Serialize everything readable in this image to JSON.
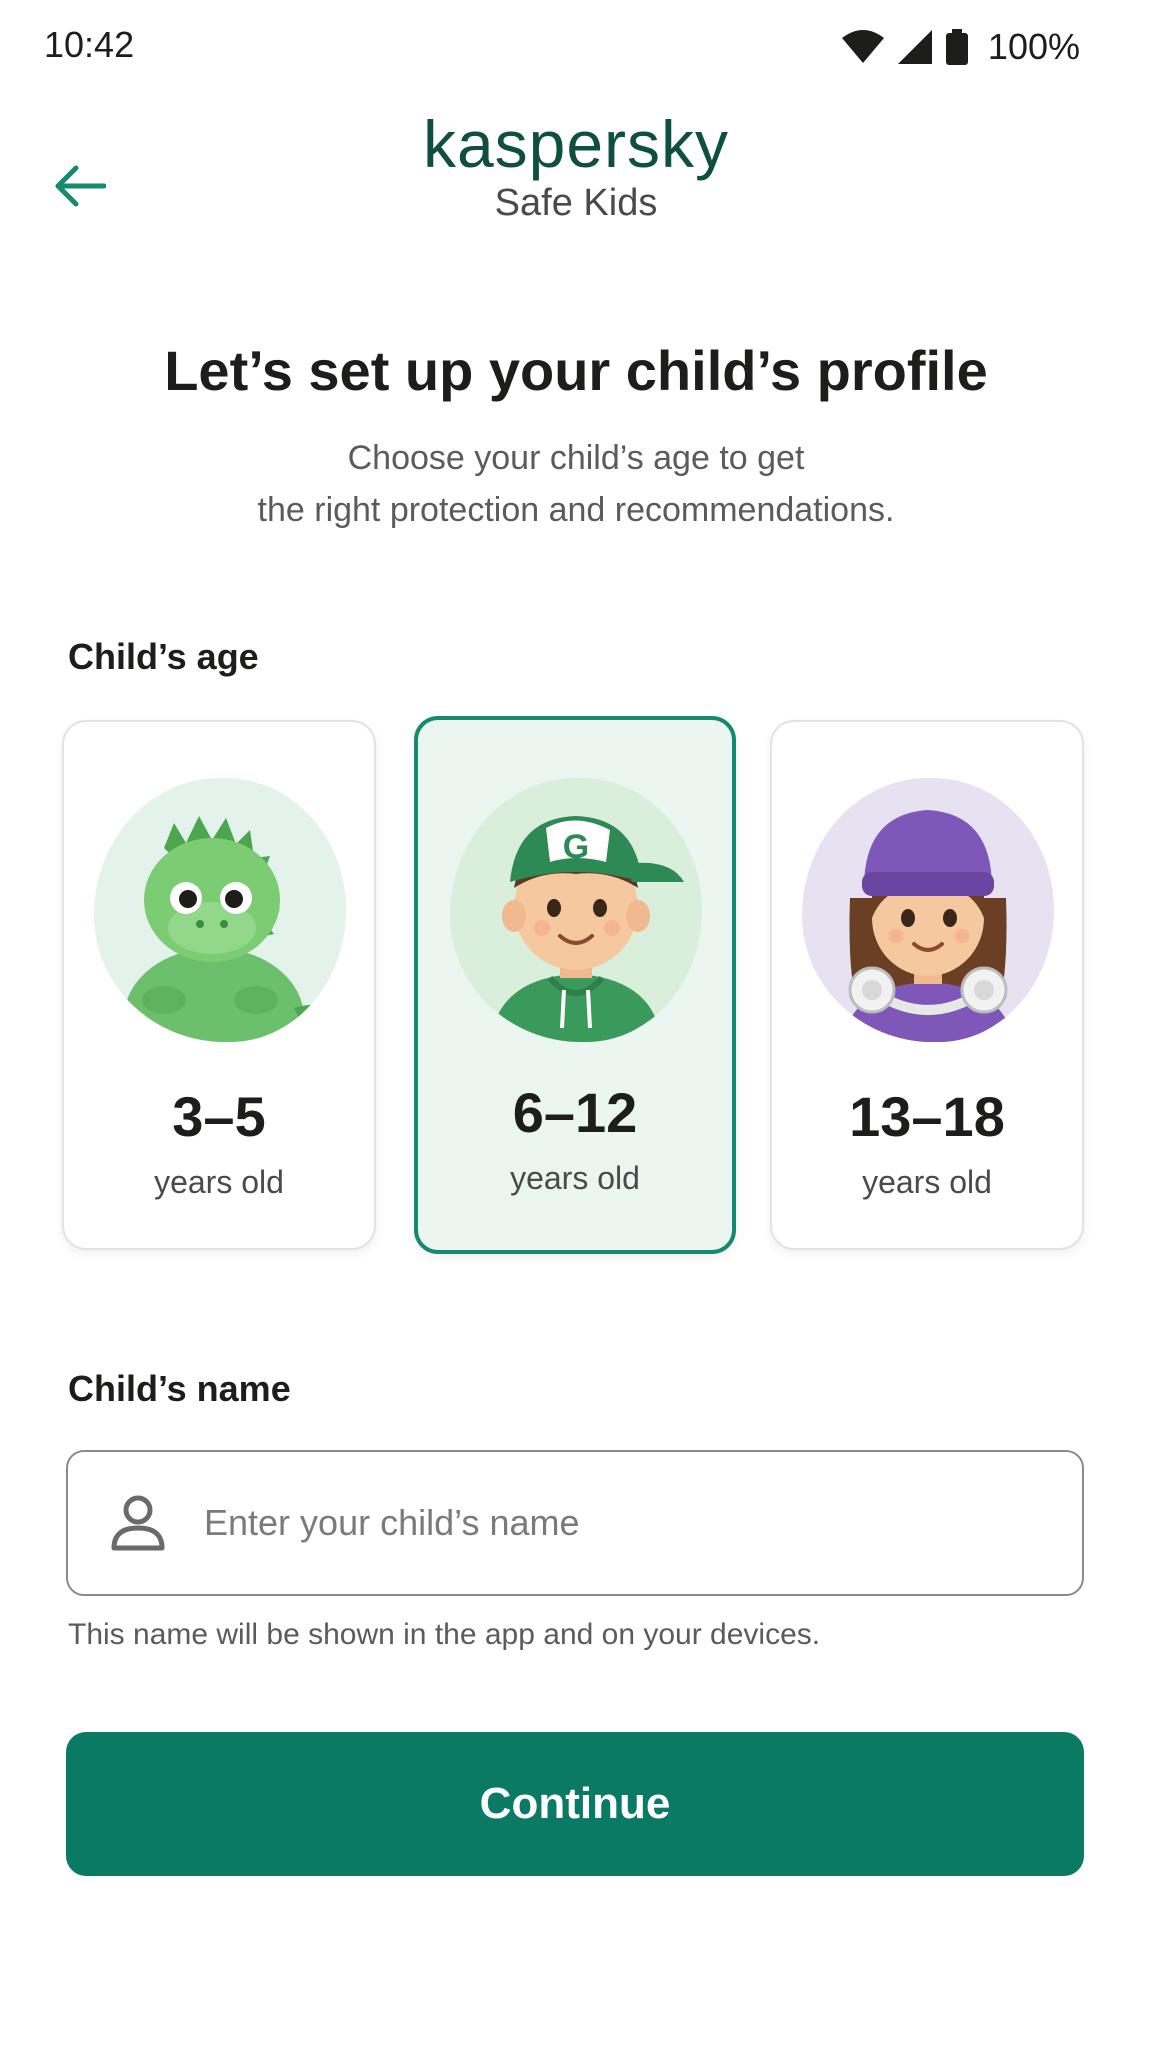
{
  "status_bar": {
    "time": "10:42",
    "battery": "100%",
    "icons": [
      "wifi-icon",
      "signal-icon",
      "battery-icon"
    ]
  },
  "header": {
    "back_icon": "arrow-left-icon",
    "brand_name": "kaspersky",
    "product_name": "Safe Kids"
  },
  "intro": {
    "title": "Let’s set up your child’s profile",
    "subtitle_line1": "Choose your child’s age to get",
    "subtitle_line2": "the right protection and recommendations."
  },
  "age_section": {
    "label": "Child’s age",
    "options": [
      {
        "range": "3–5",
        "unit": "years old",
        "avatar": "dinosaur-avatar",
        "selected": false
      },
      {
        "range": "6–12",
        "unit": "years old",
        "avatar": "boy-avatar",
        "selected": true
      },
      {
        "range": "13–18",
        "unit": "years old",
        "avatar": "teen-girl-avatar",
        "selected": false
      }
    ]
  },
  "name_section": {
    "label": "Child’s name",
    "icon": "person-icon",
    "placeholder": "Enter your child’s name",
    "value": "",
    "helper": "This name will be shown in the app and on your devices."
  },
  "actions": {
    "continue_label": "Continue"
  },
  "colors": {
    "brand_dark": "#0f4f3d",
    "accent": "#0a7a65",
    "selected_border": "#168a6e",
    "selected_bg": "#ebf6f1"
  }
}
